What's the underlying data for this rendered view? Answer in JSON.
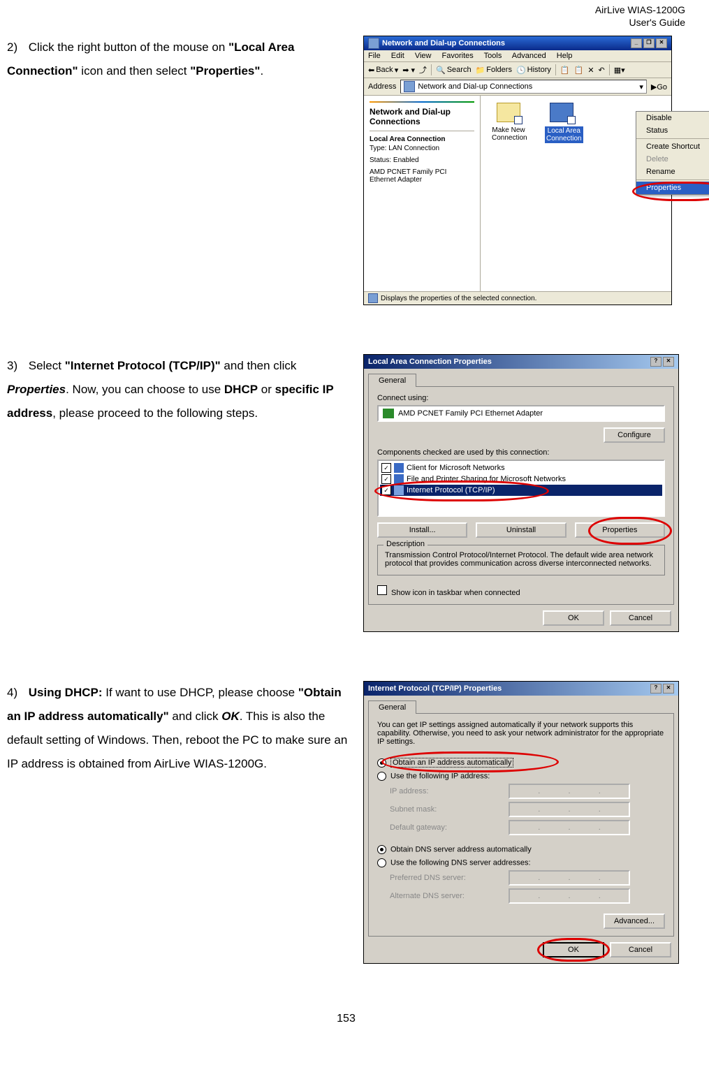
{
  "header": {
    "l1": "AirLive WIAS-1200G",
    "l2": "User's Guide"
  },
  "step2": {
    "num": "2)",
    "t1": "Click the right button of the mouse on ",
    "b1": "\"Local Area Connection\"",
    "t2": " icon and then select ",
    "b2": "\"Properties\"",
    "t3": "."
  },
  "step3": {
    "num": "3)",
    "t1": "Select ",
    "b1": "\"Internet Protocol (TCP/IP)\"",
    "t2": " and then click ",
    "bi1": "Properties",
    "t3": ". Now, you can choose to use ",
    "b2": "DHCP",
    "t4": " or ",
    "b3": "specific IP address",
    "t5": ", please proceed to the following steps."
  },
  "step4": {
    "num": "4)",
    "b1": "Using DHCP:",
    "t1": " If want to use DHCP, please choose ",
    "b2": "\"Obtain an IP address automatically\"",
    "t2": " and click ",
    "bi1": "OK",
    "t3": ". This is also the default setting of Windows. Then, reboot the PC to make sure an IP address is obtained from AirLive WIAS-1200G."
  },
  "w1": {
    "title": "Network and Dial-up Connections",
    "menus": [
      "File",
      "Edit",
      "View",
      "Favorites",
      "Tools",
      "Advanced",
      "Help"
    ],
    "tb": {
      "back": "Back",
      "search": "Search",
      "folders": "Folders",
      "history": "History"
    },
    "addr_label": "Address",
    "addr_value": "Network and Dial-up Connections",
    "go": "Go",
    "side": {
      "title": "Network and Dial-up Connections",
      "h1": "Local Area Connection",
      "k1": "Type:",
      "v1": "LAN Connection",
      "k2": "Status:",
      "v2": "Enabled",
      "k3": "AMD PCNET Family PCI Ethernet Adapter"
    },
    "icons": {
      "mk": "Make New Connection",
      "lac": "Local Area Connection"
    },
    "ctx": [
      "Disable",
      "Status",
      "",
      "Create Shortcut",
      "Delete",
      "Rename",
      "",
      "Properties"
    ],
    "status": "Displays the properties of the selected connection."
  },
  "w2": {
    "title": "Local Area Connection Properties",
    "tab": "General",
    "connect_using": "Connect using:",
    "adapter": "AMD PCNET Family PCI Ethernet Adapter",
    "configure": "Configure",
    "components": "Components checked are used by this connection:",
    "items": [
      "Client for Microsoft Networks",
      "File and Printer Sharing for Microsoft Networks",
      "Internet Protocol (TCP/IP)"
    ],
    "install": "Install...",
    "uninstall": "Uninstall",
    "properties": "Properties",
    "desc_title": "Description",
    "desc": "Transmission Control Protocol/Internet Protocol. The default wide area network protocol that provides communication across diverse interconnected networks.",
    "showicon": "Show icon in taskbar when connected",
    "ok": "OK",
    "cancel": "Cancel"
  },
  "w3": {
    "title": "Internet Protocol (TCP/IP) Properties",
    "tab": "General",
    "intro": "You can get IP settings assigned automatically if your network supports this capability. Otherwise, you need to ask your network administrator for the appropriate IP settings.",
    "r1": "Obtain an IP address automatically",
    "r2": "Use the following IP address:",
    "ip": "IP address:",
    "sn": "Subnet mask:",
    "gw": "Default gateway:",
    "r3": "Obtain DNS server address automatically",
    "r4": "Use the following DNS server addresses:",
    "pd": "Preferred DNS server:",
    "ad": "Alternate DNS server:",
    "adv": "Advanced...",
    "ok": "OK",
    "cancel": "Cancel"
  },
  "page_num": "153"
}
